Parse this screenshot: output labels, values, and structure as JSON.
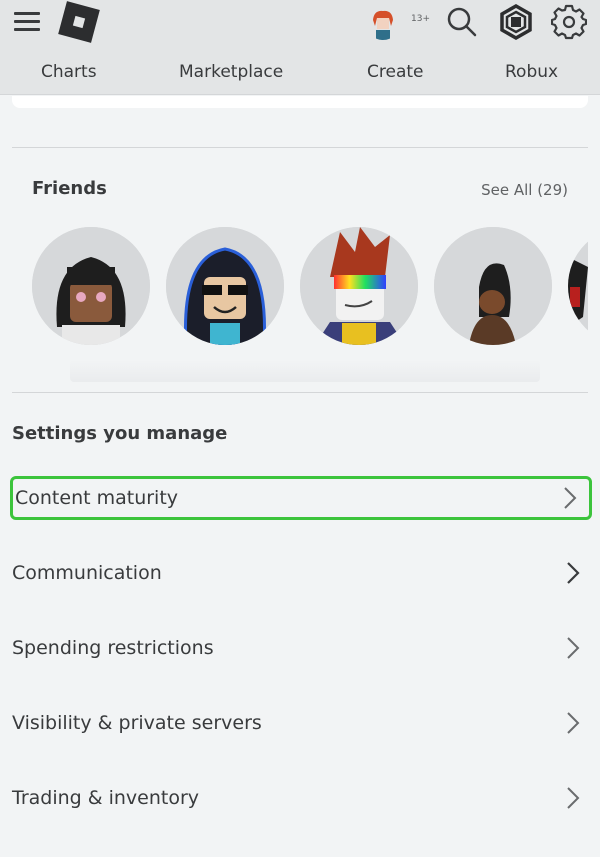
{
  "header": {
    "menu_icon": "hamburger-menu-icon",
    "logo_icon": "roblox-logo-icon",
    "age_badge": "13+",
    "icons": [
      "avatar-icon",
      "search-icon",
      "robux-icon",
      "gear-icon"
    ],
    "nav": [
      "Charts",
      "Marketplace",
      "Create",
      "Robux"
    ]
  },
  "friends": {
    "title": "Friends",
    "see_all": "See All (29)",
    "avatars": [
      {
        "name": "friend-1"
      },
      {
        "name": "friend-2"
      },
      {
        "name": "friend-3"
      },
      {
        "name": "friend-4"
      },
      {
        "name": "friend-5"
      }
    ]
  },
  "settings": {
    "title": "Settings you manage",
    "items": [
      {
        "label": "Content maturity",
        "highlighted": true
      },
      {
        "label": "Communication"
      },
      {
        "label": "Spending restrictions"
      },
      {
        "label": "Visibility & private servers"
      },
      {
        "label": "Trading & inventory"
      }
    ]
  },
  "colors": {
    "highlight": "#3cc43c",
    "header_bg": "#e3e5e6",
    "page_bg": "#f2f4f5",
    "text": "#393b3d"
  }
}
